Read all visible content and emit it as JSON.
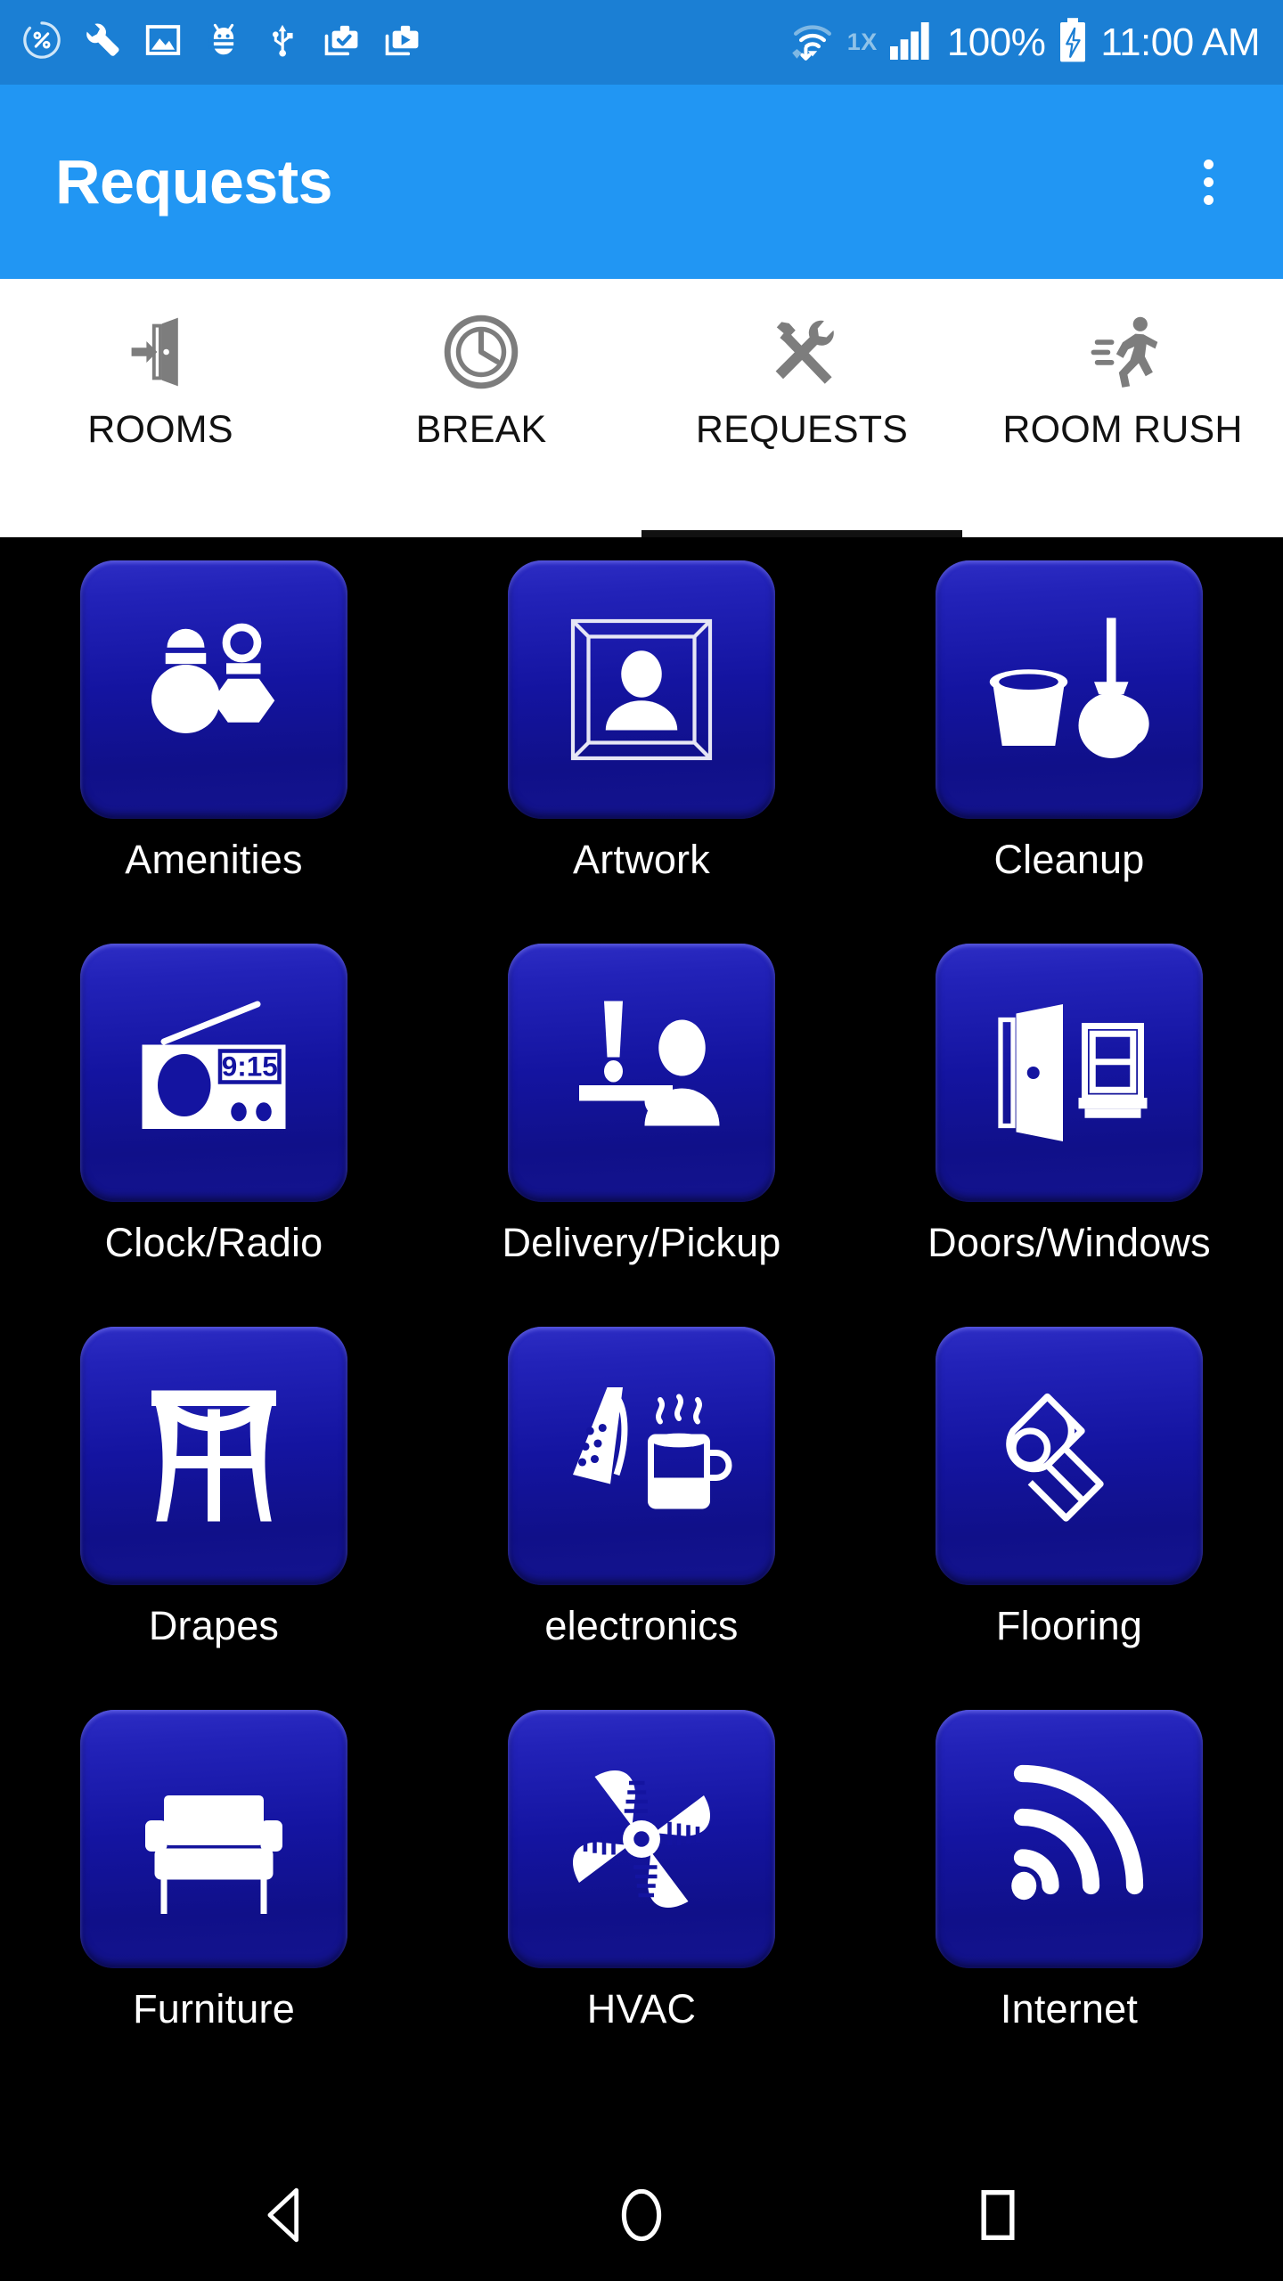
{
  "statusbar": {
    "left_icons": [
      {
        "name": "percent-circle-icon",
        "label": "%"
      },
      {
        "name": "wrench-icon",
        "label": "wrench"
      },
      {
        "name": "image-icon",
        "label": "image"
      },
      {
        "name": "android-bug-icon",
        "label": "bug"
      },
      {
        "name": "usb-icon",
        "label": "usb"
      },
      {
        "name": "work-check-icon",
        "label": "work-check"
      },
      {
        "name": "work-play-icon",
        "label": "work-play"
      }
    ],
    "wifi_icon": "wifi-transfer-icon",
    "network_type": "1X",
    "signal_icon": "cellular-signal-icon",
    "battery_percent": "100%",
    "battery_icon": "battery-charging-icon",
    "time": "11:00 AM"
  },
  "appbar": {
    "title": "Requests",
    "overflow_icon": "overflow-menu-icon"
  },
  "tabs": [
    {
      "label": "ROOMS",
      "icon": "door-exit-icon",
      "active": false
    },
    {
      "label": "BREAK",
      "icon": "clock-icon",
      "active": false
    },
    {
      "label": "REQUESTS",
      "icon": "hammer-wrench-icon",
      "active": true
    },
    {
      "label": "ROOM RUSH",
      "icon": "running-person-icon",
      "active": false
    }
  ],
  "grid": {
    "items": [
      {
        "label": "Amenities",
        "icon": "toiletries-icon"
      },
      {
        "label": "Artwork",
        "icon": "framed-portrait-icon"
      },
      {
        "label": "Cleanup",
        "icon": "bucket-mop-icon"
      },
      {
        "label": "Clock/Radio",
        "icon": "clock-radio-icon",
        "display_text": "9:15"
      },
      {
        "label": "Delivery/Pickup",
        "icon": "room-service-icon"
      },
      {
        "label": "Doors/Windows",
        "icon": "door-window-icon"
      },
      {
        "label": "Drapes",
        "icon": "curtained-window-icon"
      },
      {
        "label": "electronics",
        "icon": "iron-kettle-icon"
      },
      {
        "label": "Flooring",
        "icon": "carpet-roll-icon"
      },
      {
        "label": "Furniture",
        "icon": "sofa-icon"
      },
      {
        "label": "HVAC",
        "icon": "fan-icon"
      },
      {
        "label": "Internet",
        "icon": "wifi-waves-icon"
      }
    ]
  },
  "navbar": {
    "back_label": "back-button",
    "home_label": "home-button",
    "recents_label": "recents-button"
  },
  "colors": {
    "statusbar_bg": "#1b7fd4",
    "appbar_bg": "#2196f3",
    "tabbar_bg": "#ffffff",
    "content_bg": "#000000",
    "tile_blue": "#1414a0",
    "tab_active_indicator": "#111111"
  }
}
